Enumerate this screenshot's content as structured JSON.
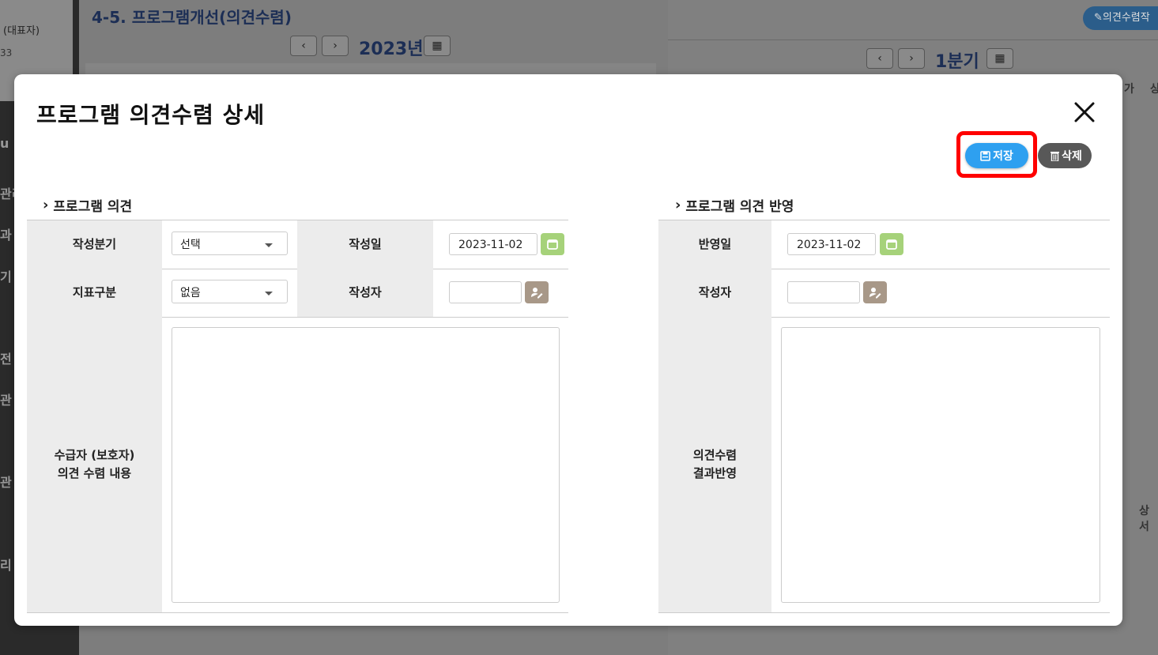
{
  "background": {
    "user_name": "(대표자)",
    "user_code": "33",
    "nav_fragments": [
      "u I",
      "관리",
      "과",
      "기",
      "전",
      "관",
      "관",
      "리"
    ],
    "page_title": "4-5. 프로그램개선(의견수렴)",
    "year_label": "2023년",
    "quarter_label": "1분기",
    "opinion_button": "의견수렴작",
    "right_labels": [
      "가",
      "상",
      "상서"
    ]
  },
  "modal": {
    "title": "프로그램 의견수렴 상세",
    "save_label": "저장",
    "delete_label": "삭제",
    "left_section": {
      "title": "프로그램 의견",
      "quarter_label": "작성분기",
      "quarter_value": "선택",
      "date_label": "작성일",
      "date_value": "2023-11-02",
      "indicator_label": "지표구분",
      "indicator_value": "없음",
      "author_label": "작성자",
      "author_value": "",
      "content_label_line1": "수급자 (보호자)",
      "content_label_line2": "의견 수렴 내용"
    },
    "right_section": {
      "title": "프로그램 의견 반영",
      "date_label": "반영일",
      "date_value": "2023-11-02",
      "author_label": "작성자",
      "author_value": "",
      "result_label_line1": "의견수렴",
      "result_label_line2": "결과반영"
    }
  },
  "colors": {
    "save": "#2ea0f0",
    "delete": "#585858",
    "highlight": "#ff0000",
    "calendar": "#a6d27a",
    "user_picker": "#a89888",
    "label_bg": "#ececec"
  }
}
